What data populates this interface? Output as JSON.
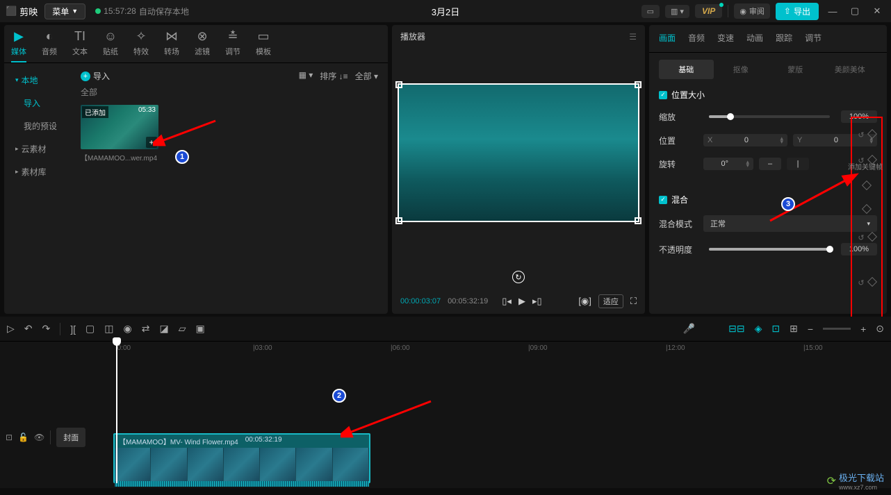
{
  "titlebar": {
    "app": "剪映",
    "menu": "菜单",
    "autosave_time": "15:57:28",
    "autosave_text": "自动保存本地",
    "doc": "3月2日",
    "vip": "VIP",
    "review": "审阅",
    "export": "导出"
  },
  "tool_tabs": [
    {
      "icon": "▶",
      "label": "媒体",
      "active": true
    },
    {
      "icon": "◐",
      "label": "音频"
    },
    {
      "icon": "TI",
      "label": "文本"
    },
    {
      "icon": "☺",
      "label": "贴纸"
    },
    {
      "icon": "✧",
      "label": "特效"
    },
    {
      "icon": "⋈",
      "label": "转场"
    },
    {
      "icon": "⊗",
      "label": "滤镜"
    },
    {
      "icon": "≡",
      "label": "调节"
    },
    {
      "icon": "▭",
      "label": "模板"
    }
  ],
  "left_side": [
    {
      "label": "本地",
      "active": true,
      "expand": true
    },
    {
      "label": "导入",
      "sub": true
    },
    {
      "label": "我的预设"
    },
    {
      "label": "云素材",
      "expand": true
    },
    {
      "label": "素材库",
      "expand": true
    }
  ],
  "media": {
    "import": "导入",
    "sort": "排序",
    "all": "全部",
    "category": "全部",
    "thumb": {
      "badge": "已添加",
      "dur": "05:33",
      "name": "【MAMAMOO...wer.mp4"
    }
  },
  "player": {
    "title": "播放器",
    "cur": "00:00:03:07",
    "tot": "00:05:32:19",
    "fit": "适应"
  },
  "prop_tabs": [
    "画面",
    "音频",
    "变速",
    "动画",
    "跟踪",
    "调节"
  ],
  "sub_tabs": [
    "基础",
    "抠像",
    "蒙版",
    "美颜美体"
  ],
  "props": {
    "pos_size": "位置大小",
    "scale": "缩放",
    "scale_val": "100%",
    "position": "位置",
    "x": "0",
    "y": "0",
    "rotate": "旋转",
    "rotate_val": "0°",
    "blend": "混合",
    "blend_mode": "混合模式",
    "blend_val": "正常",
    "opacity": "不透明度",
    "opacity_val": "100%",
    "kf_hint": "添加关键帧"
  },
  "timeline": {
    "ticks": [
      "|0:00",
      "|03:00",
      "|06:00",
      "|09:00",
      "|12:00",
      "|15:00"
    ],
    "cover": "封面",
    "clip_name": "【MAMAMOO】MV- Wind Flower.mp4",
    "clip_dur": "00:05:32:19"
  },
  "watermark": {
    "site": "极光下载站",
    "url": "www.xz7.com"
  }
}
